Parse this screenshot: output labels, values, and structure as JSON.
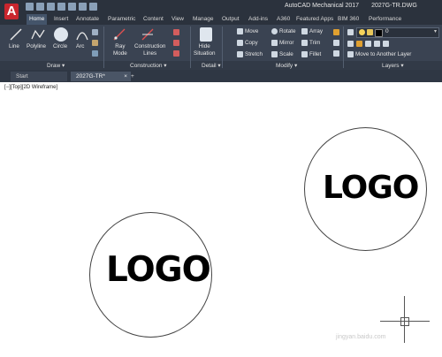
{
  "title": {
    "app": "AutoCAD Mechanical 2017",
    "file": "2027G-TR.DWG"
  },
  "app_button": {
    "letter": "A"
  },
  "ribbon_tabs": [
    "Home",
    "Insert",
    "Annotate",
    "Parametric",
    "Content",
    "View",
    "Manage",
    "Output",
    "Add-ins",
    "A360",
    "Featured Apps",
    "BIM 360",
    "Performance"
  ],
  "ribbon": {
    "draw": {
      "line": "Line",
      "polyline": "Polyline",
      "circle": "Circle",
      "arc": "Arc",
      "panel": "Draw ▾"
    },
    "construction": {
      "ray_line1": "Ray",
      "ray_line2": "Mode",
      "cl_line1": "Construction",
      "cl_line2": "Lines",
      "panel": "Construction ▾"
    },
    "detail": {
      "hide_line1": "Hide",
      "hide_line2": "Situation",
      "panel": "Detail ▾"
    },
    "modify": {
      "move": "Move",
      "rotate": "Rotate",
      "array": "Array",
      "copy": "Copy",
      "mirror": "Mirror",
      "trim": "Trim",
      "stretch": "Stretch",
      "scale": "Scale",
      "fillet": "Fillet",
      "panel": "Modify ▾"
    },
    "layers": {
      "layer_value": "0",
      "move_layer": "Move to Another Layer",
      "panel": "Layers ▾"
    }
  },
  "doc_tabs": {
    "start": "Start",
    "file": "2027G-TR*",
    "close": "×",
    "add": "+"
  },
  "viewport_label": "[−][Top][2D Wireframe]",
  "canvas": {
    "logo_left": "LOGO",
    "logo_right": "LOGO"
  },
  "watermark": "jingyan.baidu.com"
}
